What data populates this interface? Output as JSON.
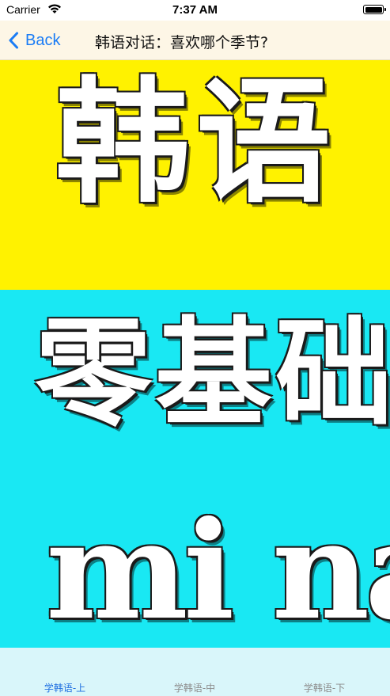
{
  "status_bar": {
    "carrier": "Carrier",
    "time": "7:37 AM"
  },
  "nav": {
    "back_label": "Back",
    "title": "韩语对话：喜欢哪个季节?"
  },
  "hero": {
    "line1": "韩语",
    "line2": "零基础",
    "line3": "mi na",
    "colors": {
      "top": "#fff200",
      "bottom": "#19e8f3"
    }
  },
  "tabs": [
    {
      "label": "学韩语-上",
      "active": true
    },
    {
      "label": "学韩语-中",
      "active": false
    },
    {
      "label": "学韩语-下",
      "active": false
    }
  ],
  "colors": {
    "accent": "#1a7cf5",
    "tab_active": "#1f6fe0",
    "tab_inactive": "#8c8c8c"
  }
}
